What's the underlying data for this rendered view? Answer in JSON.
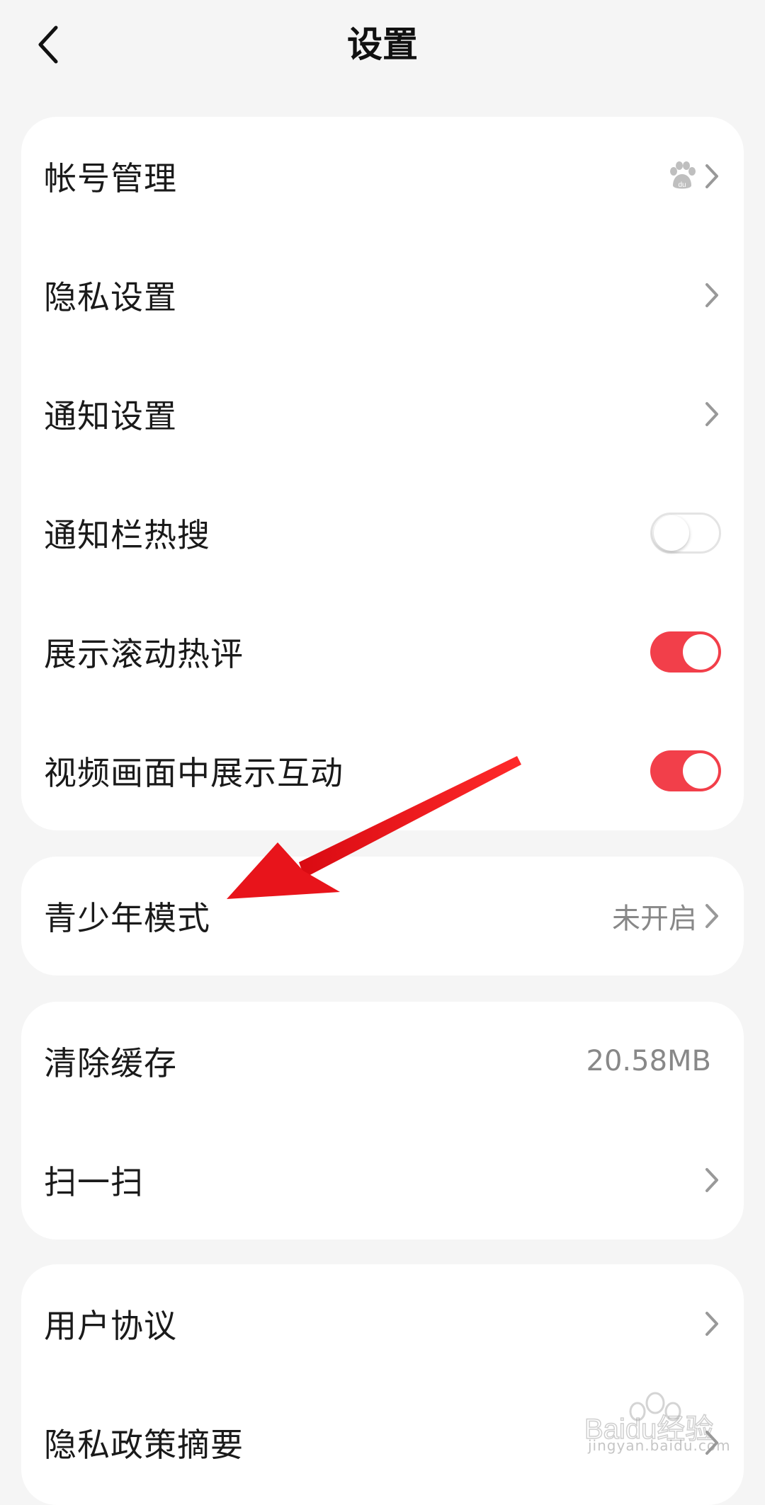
{
  "header": {
    "title": "设置",
    "back_icon": "chevron-left-icon"
  },
  "card1": {
    "account": {
      "label": "帐号管理",
      "icon": "baidu-paw-icon"
    },
    "privacy": {
      "label": "隐私设置"
    },
    "notify": {
      "label": "通知设置"
    },
    "hot_search": {
      "label": "通知栏热搜",
      "toggle": false
    },
    "scroll_comments": {
      "label": "展示滚动热评",
      "toggle": true
    },
    "video_interact": {
      "label": "视频画面中展示互动",
      "toggle": true
    }
  },
  "card2": {
    "teen": {
      "label": "青少年模式",
      "value": "未开启"
    }
  },
  "card3": {
    "cache": {
      "label": "清除缓存",
      "value": "20.58MB"
    },
    "scan": {
      "label": "扫一扫"
    }
  },
  "card4": {
    "agreement": {
      "label": "用户协议"
    },
    "policy_summary": {
      "label": "隐私政策摘要"
    }
  },
  "watermark": {
    "brand": "Baidu经验",
    "url": "jingyan.baidu.com"
  },
  "colors": {
    "accent": "#f23f4a",
    "arrow": "#e8141b",
    "background": "#f5f5f5"
  }
}
